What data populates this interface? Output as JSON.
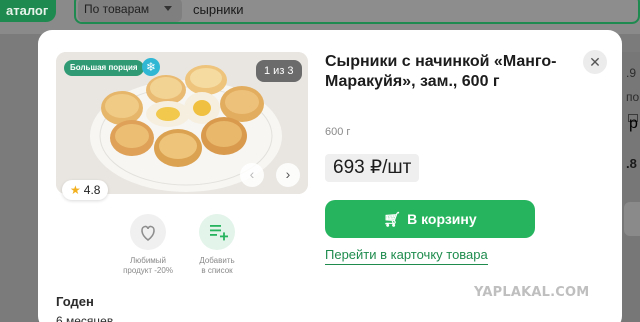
{
  "background": {
    "catalog_label": "аталог",
    "search_scope": "По товарам",
    "search_query": "сырники",
    "right_texts": [
      ".9",
      "по",
      "р",
      ".8"
    ]
  },
  "gallery": {
    "badge_portion": "Большая порция",
    "counter": "1 из 3",
    "rating": "4.8"
  },
  "actions": [
    {
      "label_line1": "Любимый",
      "label_line2": "продукт -20%"
    },
    {
      "label_line1": "Добавить",
      "label_line2": "в список"
    }
  ],
  "product": {
    "title": "Сырники с начинкой «Манго-Маракуйя», зам., 600 г",
    "weight": "600 г",
    "price": "693 ₽/шт",
    "cart_label": "В корзину",
    "details_link": "Перейти в карточку товара"
  },
  "details": {
    "section_title": "Годен",
    "section_value": "6 месяцев"
  },
  "watermark": "YAPLAKAL.COM",
  "colors": {
    "accent": "#27b45f",
    "link": "#1f8c4e",
    "badge": "#2f9a74"
  }
}
